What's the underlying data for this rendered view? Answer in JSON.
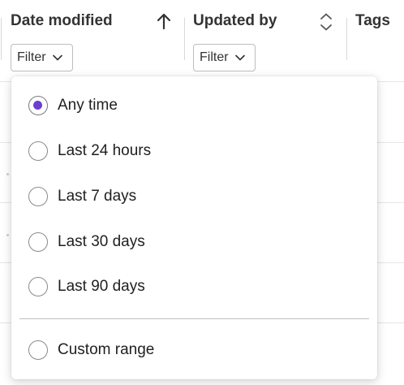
{
  "columns": [
    {
      "title": "Date modified",
      "sort_icon": "arrow-up-icon",
      "filter_label": "Filter"
    },
    {
      "title": "Updated by",
      "sort_icon": "sort-toggle-icon",
      "filter_label": "Filter"
    },
    {
      "title": "Tags"
    }
  ],
  "date_filter_menu": {
    "selected": "Any time",
    "options": [
      "Any time",
      "Last 24 hours",
      "Last 7 days",
      "Last 30 days",
      "Last 90 days"
    ],
    "custom_option": "Custom range"
  },
  "colors": {
    "accent": "#6a3fd1",
    "border": "#bdbdbd",
    "text": "#1f1f1f"
  }
}
